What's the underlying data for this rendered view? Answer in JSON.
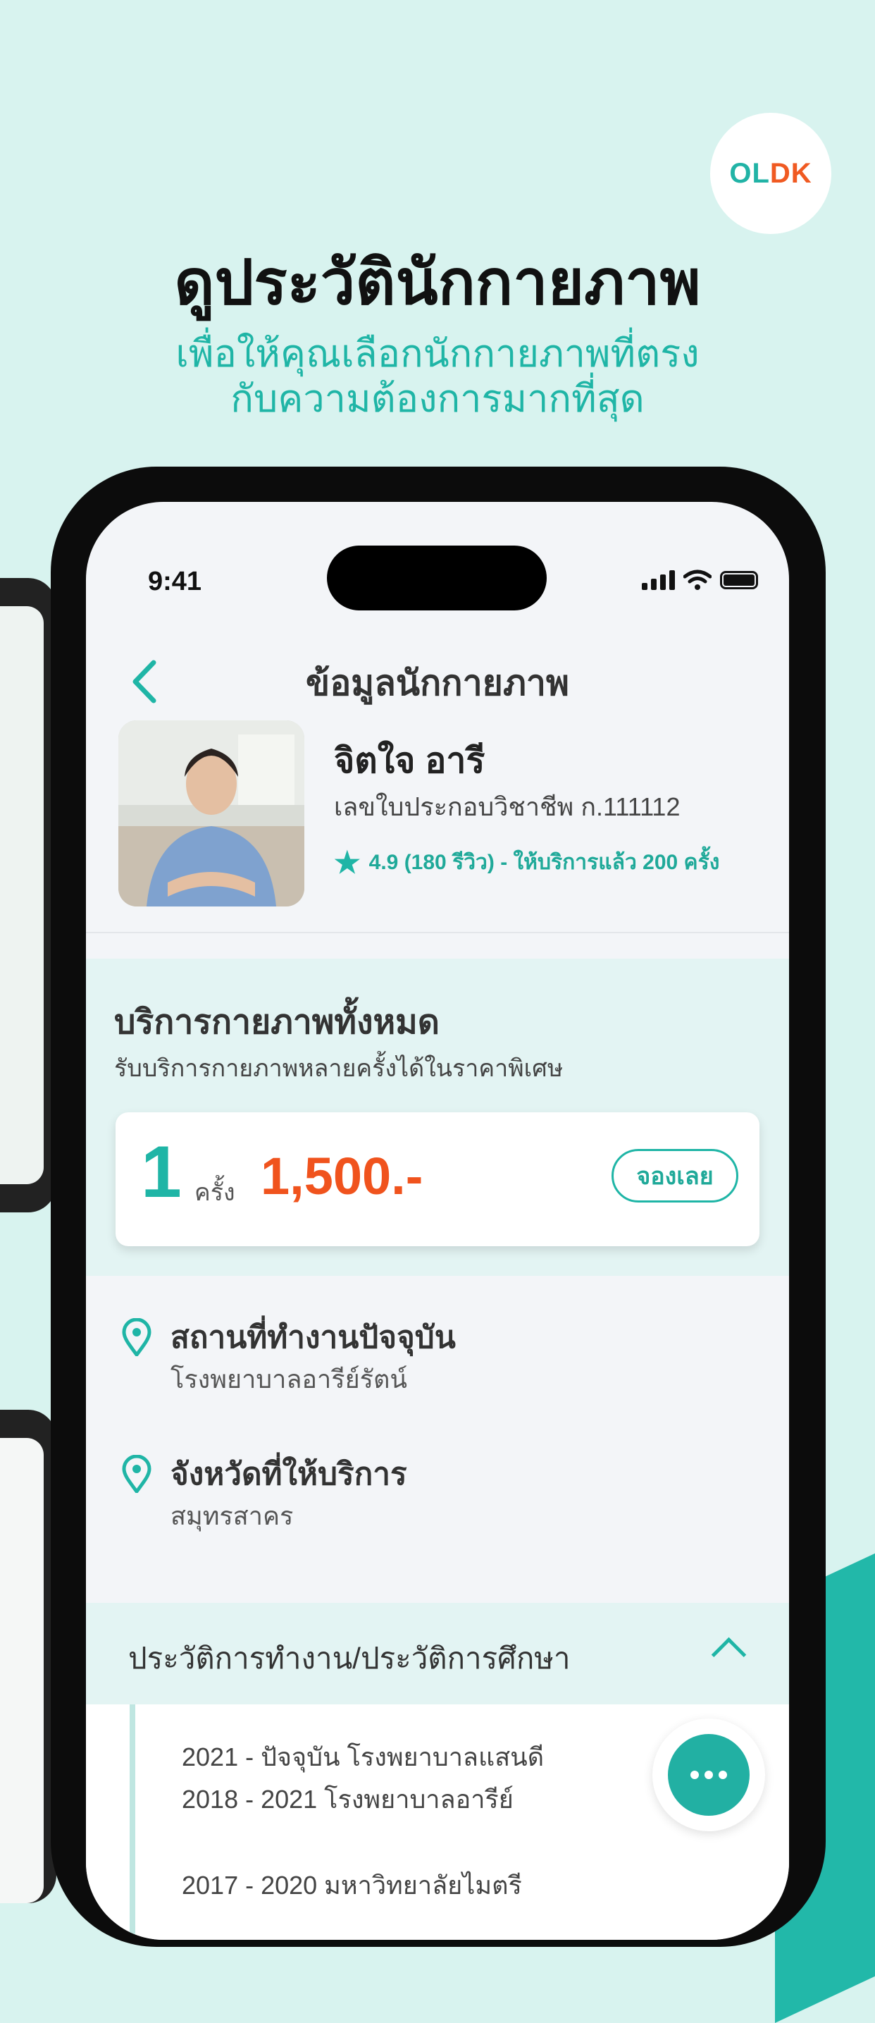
{
  "brand": {
    "logo_o": "O",
    "logo_l": "L",
    "logo_dk": "DK"
  },
  "hero": {
    "title": "ดูประวัตินักกายภาพ",
    "subtitle_line1": "เพื่อให้คุณเลือกนักกายภาพที่ตรง",
    "subtitle_line2": "กับความต้องการมากที่สุด"
  },
  "status_bar": {
    "time": "9:41"
  },
  "nav": {
    "title": "ข้อมูลนักกายภาพ",
    "back_icon": "chevron-left-icon"
  },
  "profile": {
    "name": "จิตใจ อารี",
    "license": "เลขใบประกอบวิชาชีพ ก.111112",
    "rating_text": "4.9 (180 รีวิว) -  ให้บริการแล้ว 200 ครั้ง"
  },
  "services": {
    "title": "บริการกายภาพทั้งหมด",
    "subtitle": "รับบริการกายภาพหลายครั้งได้ในราคาพิเศษ",
    "package": {
      "count": "1",
      "unit": "ครั้ง",
      "price": "1,500.-",
      "book_label": "จองเลย"
    }
  },
  "info": {
    "workplace_title": "สถานที่ทำงานปัจจุบัน",
    "workplace_value": "โรงพยาบาลอารีย์รัตน์",
    "province_title": "จังหวัดที่ให้บริการ",
    "province_value": "สมุทรสาคร"
  },
  "history": {
    "title": "ประวัติการทำงาน/ประวัติการศึกษา",
    "lines": [
      "2021 - ปัจจุบัน โรงพยาบาลแสนดี",
      "2018 - 2021 โรงพยาบาลอารีย์",
      "2017 - 2020 มหาวิทยาลัยไมตรี"
    ]
  },
  "colors": {
    "accent": "#1fb5a6",
    "price": "#f0531d",
    "background": "#d8f3ef"
  }
}
